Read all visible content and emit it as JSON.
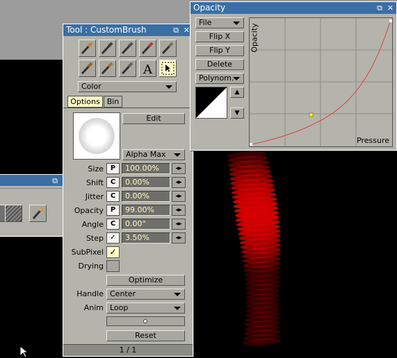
{
  "tool_window": {
    "title": "Tool : CustomBrush",
    "menu_icon": "⧉",
    "close_icon": "✕",
    "tools": [
      "brush-icon",
      "pen-icon",
      "airbrush-icon",
      "eraser-icon",
      "marker-icon",
      "paintbrush-icon",
      "smudge-icon",
      "blend-icon",
      "text-icon",
      "selection-icon"
    ],
    "color_dropdown": "Color",
    "tabs": [
      "Options",
      "Bin"
    ],
    "edit_label": "Edit",
    "source_dropdown": "Alpha Max",
    "params": [
      {
        "label": "Size",
        "mode": "P",
        "value": "100.00%"
      },
      {
        "label": "Shift",
        "mode": "C",
        "value": "0.00%"
      },
      {
        "label": "Jitter",
        "mode": "C",
        "value": "0.00%"
      },
      {
        "label": "Opacity",
        "mode": "P",
        "value": "99.00%"
      },
      {
        "label": "Angle",
        "mode": "C",
        "value": "0.00°"
      },
      {
        "label": "Step",
        "mode": "✓",
        "value": "3.50%"
      }
    ],
    "subpixel_label": "SubPixel",
    "drying_label": "Drying",
    "optimize_label": "Optimize",
    "handle_label": "Handle",
    "handle_value": "Center",
    "anim_label": "Anim",
    "anim_value": "Loop",
    "reset_label": "Reset",
    "page_indicator": "1 / 1"
  },
  "opacity_window": {
    "title": "Opacity",
    "menu_icon": "⧉",
    "close_icon": "✕",
    "file_dropdown": "File",
    "flipx_label": "Flip X",
    "flipy_label": "Flip Y",
    "delete_label": "Delete",
    "mode_dropdown": "Polynom.",
    "y_axis_label": "Opacity",
    "x_axis_label": "Pressure",
    "curve_color": "#e04040"
  },
  "small_window": {
    "menu_icon": "⧉",
    "close_icon": "✕"
  }
}
